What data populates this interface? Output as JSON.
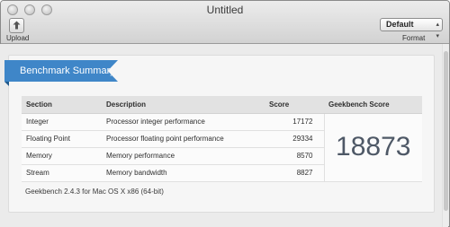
{
  "window": {
    "title": "Untitled"
  },
  "toolbar": {
    "upload_label": "Upload",
    "format_label": "Format",
    "format_value": "Default"
  },
  "summary": {
    "ribbon_label": "Benchmark Summary",
    "headers": {
      "section": "Section",
      "description": "Description",
      "score": "Score",
      "geekbench": "Geekbench Score"
    },
    "rows": [
      {
        "section": "Integer",
        "description": "Processor integer performance",
        "score": "17172"
      },
      {
        "section": "Floating Point",
        "description": "Processor floating point performance",
        "score": "29334"
      },
      {
        "section": "Memory",
        "description": "Memory performance",
        "score": "8570"
      },
      {
        "section": "Stream",
        "description": "Memory bandwidth",
        "score": "8827"
      }
    ],
    "geekbench_score": "18873",
    "footer": "Geekbench 2.4.3 for Mac OS X x86 (64-bit)"
  }
}
